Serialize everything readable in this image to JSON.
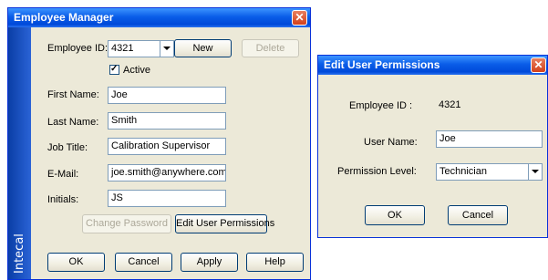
{
  "employee_manager": {
    "title": "Employee Manager",
    "close_glyph": "✕",
    "sidebar_brand": "Intecal",
    "employee_id_label": "Employee ID:",
    "employee_id_value": "4321",
    "new_button": "New",
    "delete_button": "Delete",
    "active_checked": true,
    "active_label": "Active",
    "first_name_label": "First Name:",
    "first_name_value": "Joe",
    "last_name_label": "Last Name:",
    "last_name_value": "Smith",
    "job_title_label": "Job Title:",
    "job_title_value": "Calibration Supervisor",
    "email_label": "E-Mail:",
    "email_value": "joe.smith@anywhere.com",
    "initials_label": "Initials:",
    "initials_value": "JS",
    "change_password_button": "Change Password",
    "edit_permissions_button": "Edit User Permissions",
    "ok_button": "OK",
    "cancel_button": "Cancel",
    "apply_button": "Apply",
    "help_button": "Help"
  },
  "edit_permissions": {
    "title": "Edit User Permissions",
    "close_glyph": "✕",
    "employee_id_label": "Employee ID :",
    "employee_id_value": "4321",
    "user_name_label": "User Name:",
    "user_name_value": "Joe",
    "permission_level_label": "Permission Level:",
    "permission_level_value": "Technician",
    "ok_button": "OK",
    "cancel_button": "Cancel"
  },
  "colors": {
    "title_bar": "#0a5de8",
    "window_bg": "#ece9d8",
    "close_button": "#d3411b",
    "sidebar": "#1a4fc0"
  },
  "icons": [
    "close-icon",
    "chevron-down-icon",
    "checkmark-icon"
  ]
}
